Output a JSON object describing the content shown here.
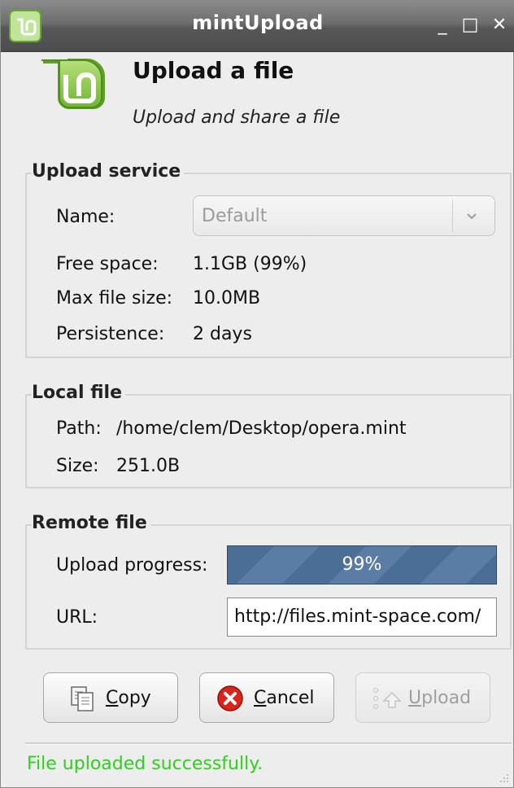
{
  "window": {
    "title": "mintUpload",
    "controls": {
      "minimize": "_",
      "maximize": "□",
      "close": "✕"
    }
  },
  "header": {
    "title": "Upload a file",
    "subtitle": "Upload and share a file",
    "logo_icon": "mint-logo-icon"
  },
  "upload_service": {
    "frame_label": "Upload service",
    "name_label": "Name:",
    "name_value": "Default",
    "free_space_label": "Free space:",
    "free_space_value": "1.1GB (99%)",
    "max_size_label": "Max file size:",
    "max_size_value": "10.0MB",
    "persistence_label": "Persistence:",
    "persistence_value": "2 days"
  },
  "local_file": {
    "frame_label": "Local file",
    "path_label": "Path:",
    "path_value": "/home/clem/Desktop/opera.mint",
    "size_label": "Size:",
    "size_value": "251.0B"
  },
  "remote_file": {
    "frame_label": "Remote file",
    "progress_label": "Upload progress:",
    "progress_text": "99%",
    "progress_fraction": 0.99,
    "url_label": "URL:",
    "url_value": "http://files.mint-space.com/"
  },
  "buttons": {
    "copy": {
      "label_first": "C",
      "label_rest": "opy",
      "icon": "copy-icon"
    },
    "cancel": {
      "label_first": "C",
      "label_rest": "ancel",
      "icon": "cancel-icon"
    },
    "upload": {
      "label_first": "U",
      "label_rest": "pload",
      "icon": "upload-icon",
      "enabled": false
    }
  },
  "status": {
    "message": "File uploaded successfully.",
    "color": "#2cd21a"
  },
  "colors": {
    "titlebar": "#575757",
    "progress": "#4c6d95",
    "mint_green": "#8ccf4c"
  }
}
